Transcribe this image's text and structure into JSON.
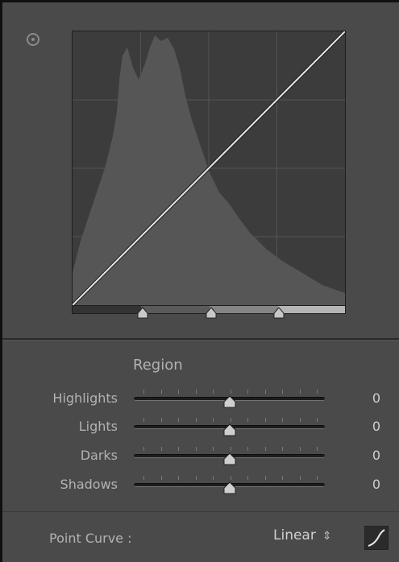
{
  "panel": {
    "target_icon": "target-adjust-icon",
    "curve": {
      "mode": "linear",
      "line_color": "#e8e8e8",
      "histogram_color": "#565656",
      "grid_color": "#555555"
    },
    "split_points": [
      25,
      50,
      75
    ],
    "region": {
      "title": "Region",
      "sliders": [
        {
          "label": "Highlights",
          "value": "0",
          "level": 0.5
        },
        {
          "label": "Lights",
          "value": "0",
          "level": 0.5
        },
        {
          "label": "Darks",
          "value": "0",
          "level": 0.5
        },
        {
          "label": "Shadows",
          "value": "0",
          "level": 0.5
        }
      ]
    },
    "footer": {
      "point_curve_label": "Point Curve :",
      "point_curve_value": "Linear",
      "selector_icon": "up-down-arrows-icon",
      "edit_icon": "edit-point-curve-icon"
    }
  }
}
